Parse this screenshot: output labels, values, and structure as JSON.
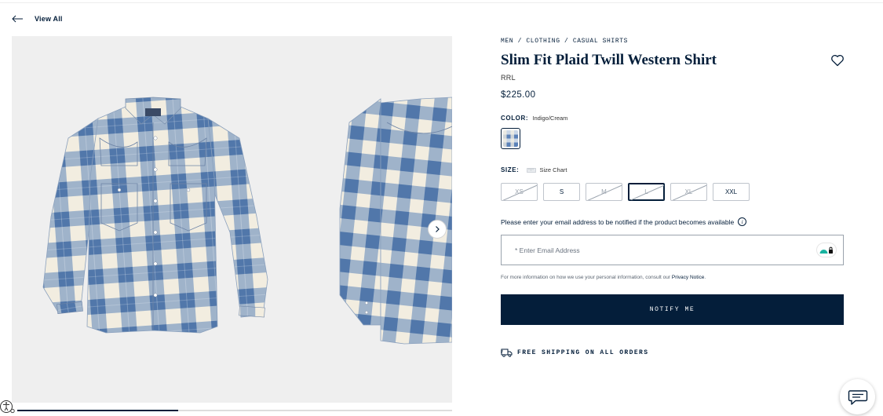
{
  "nav": {
    "back_label": "View All"
  },
  "breadcrumb": "MEN / CLOTHING / CASUAL SHIRTS",
  "product": {
    "title": "Slim Fit Plaid Twill Western Shirt",
    "brand": "RRL",
    "price": "$225.00",
    "color_label": "COLOR:",
    "color_value": "Indigo/Cream"
  },
  "size": {
    "label": "SIZE:",
    "chart_label": "Size Chart",
    "options": [
      "XS",
      "S",
      "M",
      "L",
      "XL",
      "XXL"
    ],
    "unavailable": [
      "XS",
      "M",
      "L",
      "XL"
    ],
    "selected": "L"
  },
  "notify": {
    "message": "Please enter your email address to be notified if the product becomes available",
    "email_placeholder": "* Enter Email Address",
    "privacy_text": "For more information on how we use your personal information, consult our ",
    "privacy_link": "Privacy Notice",
    "privacy_end": ".",
    "button_label": "NOTIFY ME"
  },
  "shipping": {
    "text": "FREE SHIPPING ON ALL ORDERS"
  },
  "gallery": {
    "progress": 0.37
  },
  "colors": {
    "navy": "#041e3a",
    "shirt_blue": "#5b82b8",
    "shirt_cream": "#f2ede0",
    "gallery_bg": "#efefef"
  },
  "icons": [
    "back-arrow-icon",
    "heart-icon",
    "chevron-right-icon",
    "ruler-icon",
    "info-icon",
    "truck-icon",
    "chat-icon",
    "accessibility-icon"
  ]
}
